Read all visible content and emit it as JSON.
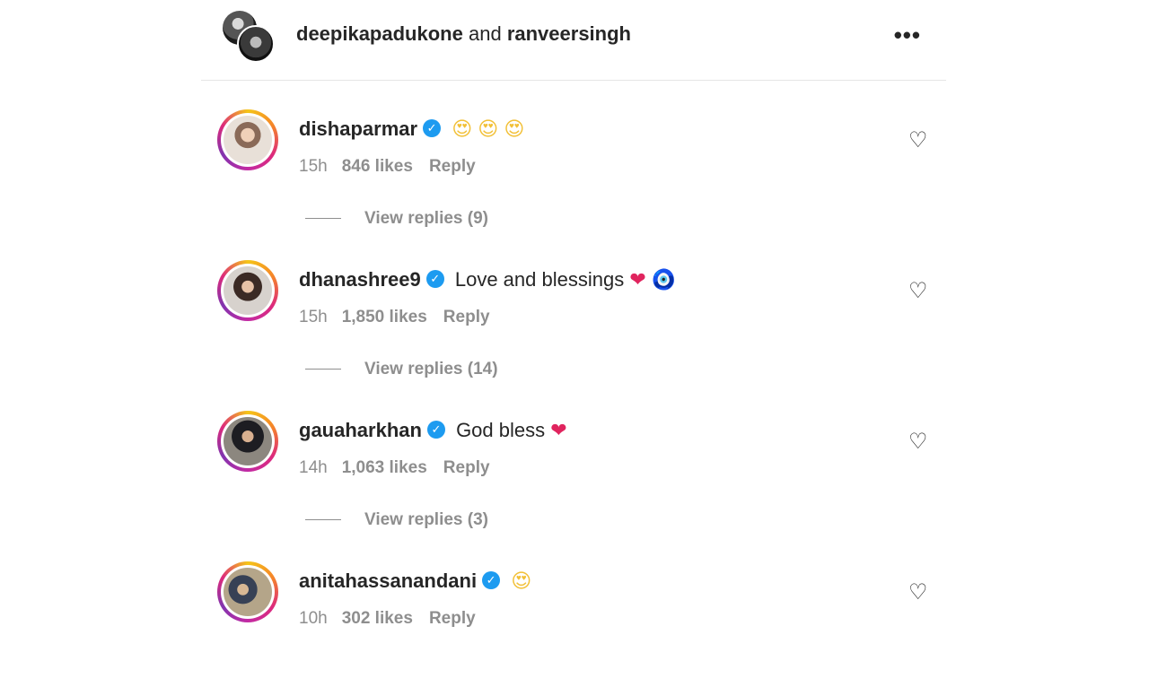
{
  "header": {
    "user1": "deepikapadukone",
    "joiner": "and",
    "user2": "ranveersingh",
    "more_icon": "more-horizontal-icon"
  },
  "comments": [
    {
      "username": "dishaparmar",
      "text": "",
      "emojis": [
        "😍",
        "😍",
        "😍"
      ],
      "time": "15h",
      "likes": "846 likes",
      "reply": "Reply",
      "view_replies": "View replies (9)"
    },
    {
      "username": "dhanashree9",
      "text": "Love and blessings",
      "emojis": [
        "❤",
        "🧿"
      ],
      "time": "15h",
      "likes": "1,850 likes",
      "reply": "Reply",
      "view_replies": "View replies (14)"
    },
    {
      "username": "gauaharkhan",
      "text": "God bless",
      "emojis": [
        "❤"
      ],
      "time": "14h",
      "likes": "1,063 likes",
      "reply": "Reply",
      "view_replies": "View replies (3)"
    },
    {
      "username": "anitahassanandani",
      "text": "",
      "emojis": [
        "😍"
      ],
      "time": "10h",
      "likes": "302 likes",
      "reply": "Reply"
    }
  ],
  "colors": {
    "verified": "#1d9bf0",
    "secondary_text": "#8e8e8e",
    "primary_text": "#262626"
  }
}
